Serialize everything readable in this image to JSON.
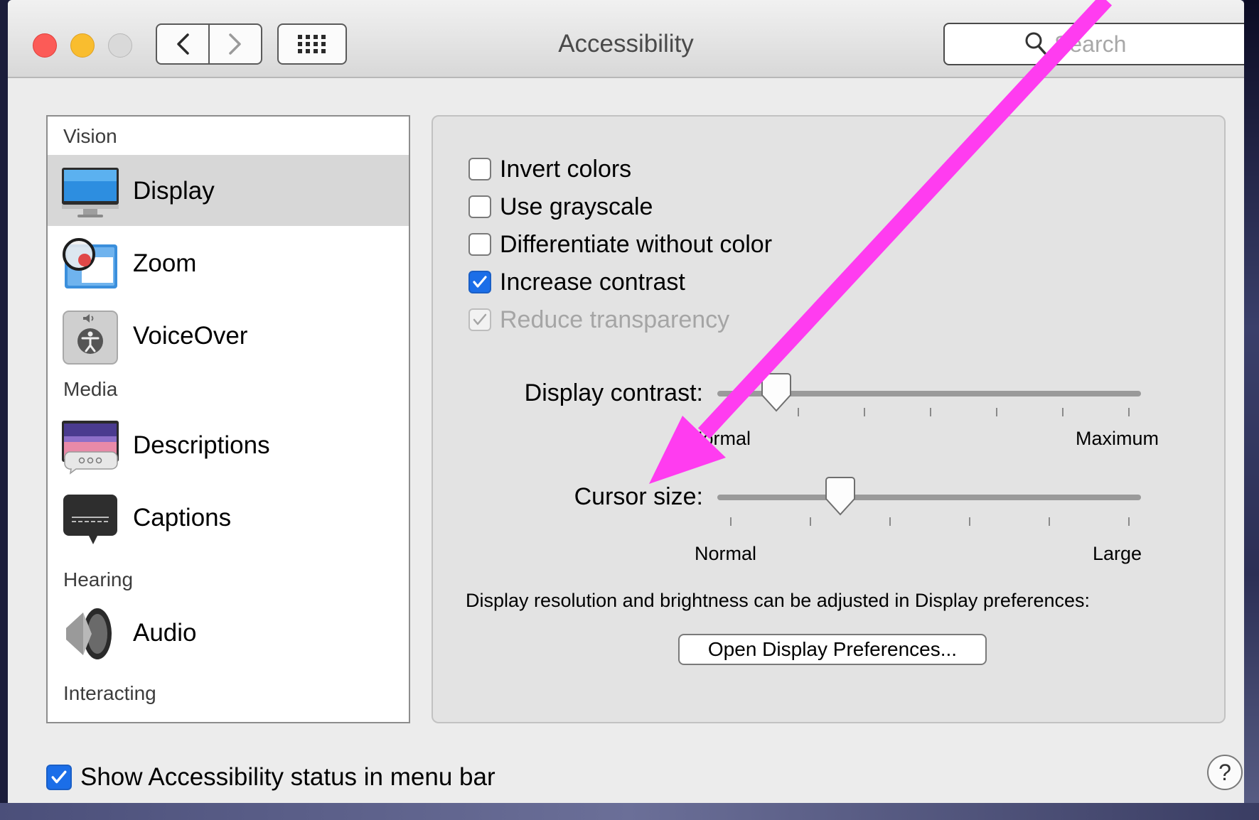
{
  "window": {
    "title": "Accessibility",
    "search_placeholder": "Search"
  },
  "sidebar": {
    "sections": [
      {
        "label": "Vision"
      },
      {
        "label": "Media"
      },
      {
        "label": "Hearing"
      },
      {
        "label": "Interacting"
      }
    ],
    "items": [
      {
        "label": "Display",
        "icon": "display-icon",
        "selected": true
      },
      {
        "label": "Zoom",
        "icon": "zoom-icon"
      },
      {
        "label": "VoiceOver",
        "icon": "voiceover-icon"
      },
      {
        "label": "Descriptions",
        "icon": "descriptions-icon"
      },
      {
        "label": "Captions",
        "icon": "captions-icon"
      },
      {
        "label": "Audio",
        "icon": "speaker-icon"
      }
    ]
  },
  "options": [
    {
      "label": "Invert colors",
      "checked": false
    },
    {
      "label": "Use grayscale",
      "checked": false
    },
    {
      "label": "Differentiate without color",
      "checked": false
    },
    {
      "label": "Increase contrast",
      "checked": true
    },
    {
      "label": "Reduce transparency",
      "checked": true,
      "disabled": true
    }
  ],
  "display_contrast": {
    "label": "Display contrast:",
    "min_label": "Normal",
    "max_label": "Maximum",
    "value_fraction": 0.14
  },
  "cursor_size": {
    "label": "Cursor size:",
    "min_label": "Normal",
    "max_label": "Large",
    "value_fraction": 0.29
  },
  "info_text": "Display resolution and brightness can be adjusted in Display preferences:",
  "open_display_button": "Open Display Preferences...",
  "show_status": {
    "label": "Show Accessibility status in menu bar",
    "checked": true
  },
  "help_button": "?",
  "colors": {
    "accent": "#1b6ee8",
    "annotation_arrow": "#ff3cf0"
  }
}
